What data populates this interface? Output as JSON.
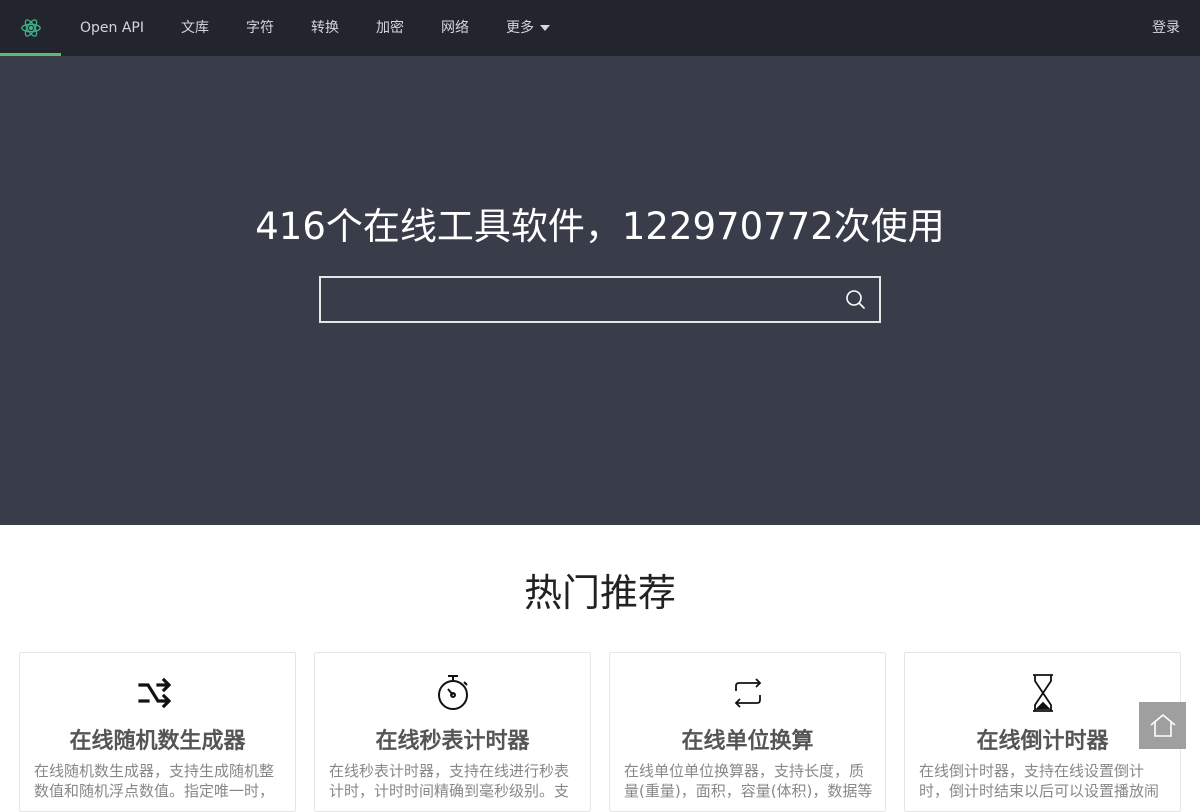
{
  "nav": {
    "logo_icon": "atom-logo-icon",
    "items": [
      {
        "label": "Open API"
      },
      {
        "label": "文库"
      },
      {
        "label": "字符"
      },
      {
        "label": "转换"
      },
      {
        "label": "加密"
      },
      {
        "label": "网络"
      },
      {
        "label": "更多"
      }
    ],
    "login_label": "登录",
    "accent_color": "#5fb878"
  },
  "hero": {
    "title": "416个在线工具软件，122970772次使用",
    "search": {
      "value": "",
      "placeholder": ""
    },
    "background_color": "#393d49"
  },
  "section": {
    "title": "热门推荐"
  },
  "cards": [
    {
      "icon": "shuffle-icon",
      "title": "在线随机数生成器",
      "desc": "在线随机数生成器，支持生成随机整数值和随机浮点数值。指定唯一时，"
    },
    {
      "icon": "stopwatch-icon",
      "title": "在线秒表计时器",
      "desc": "在线秒表计时器，支持在线进行秒表计时，计时时间精确到毫秒级别。支"
    },
    {
      "icon": "repeat-icon",
      "title": "在线单位换算",
      "desc": "在线单位单位换算器，支持长度，质量(重量)，面积，容量(体积)，数据等"
    },
    {
      "icon": "hourglass-icon",
      "title": "在线倒计时器",
      "desc": "在线倒计时器，支持在线设置倒计时，倒计时结束以后可以设置播放闹"
    }
  ],
  "back_to_top": {
    "icon": "home-icon"
  }
}
